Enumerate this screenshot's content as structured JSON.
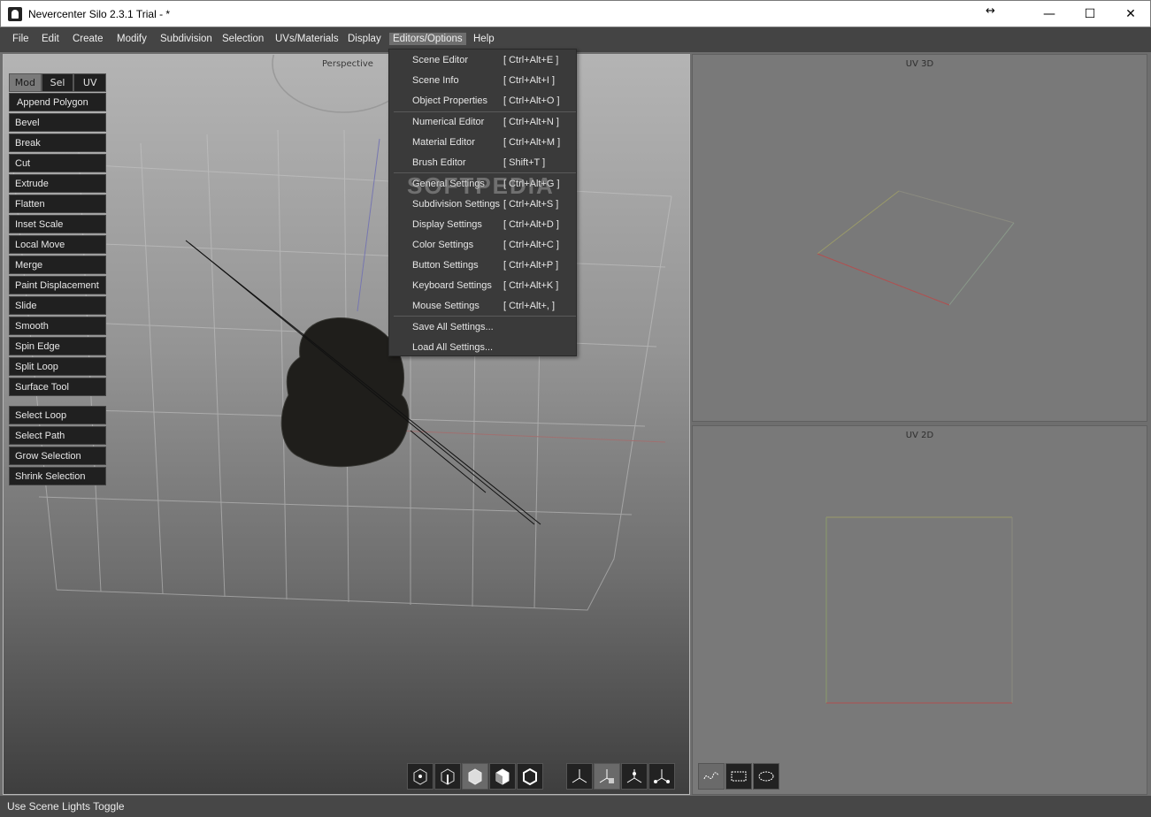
{
  "window": {
    "title": "Nevercenter Silo 2.3.1 Trial - *"
  },
  "menubar": {
    "items": [
      "File",
      "Edit",
      "Create",
      "Modify",
      "Subdivision",
      "Selection",
      "UVs/Materials",
      "Display",
      "Editors/Options",
      "Help"
    ]
  },
  "viewport": {
    "label": "Perspective"
  },
  "uv3d": {
    "label": "UV 3D"
  },
  "uv2d": {
    "label": "UV 2D"
  },
  "toolbox": {
    "tabs": [
      "Mod",
      "Sel",
      "UV"
    ],
    "tools": [
      "Append Polygon",
      "Bevel",
      "Break",
      "Cut",
      "Extrude",
      "Flatten",
      "Inset Scale",
      "Local Move",
      "Merge",
      "Paint Displacement",
      "Slide",
      "Smooth",
      "Spin Edge",
      "Split Loop",
      "Surface Tool"
    ],
    "selection_tools": [
      "Select Loop",
      "Select Path",
      "Grow Selection",
      "Shrink Selection"
    ]
  },
  "dropdown": {
    "items": [
      {
        "label": "Scene Editor",
        "shortcut": "[ Ctrl+Alt+E ]"
      },
      {
        "label": "Scene Info",
        "shortcut": "[ Ctrl+Alt+I ]"
      },
      {
        "label": "Object Properties",
        "shortcut": "[ Ctrl+Alt+O ]"
      },
      {
        "label": "Numerical Editor",
        "shortcut": "[ Ctrl+Alt+N ]"
      },
      {
        "label": "Material Editor",
        "shortcut": "[ Ctrl+Alt+M ]"
      },
      {
        "label": "Brush Editor",
        "shortcut": "[ Shift+T ]"
      },
      {
        "label": "General Settings",
        "shortcut": "[ Ctrl+Alt+G ]"
      },
      {
        "label": "Subdivision Settings",
        "shortcut": "[ Ctrl+Alt+S ]"
      },
      {
        "label": "Display Settings",
        "shortcut": "[ Ctrl+Alt+D ]"
      },
      {
        "label": "Color Settings",
        "shortcut": "[ Ctrl+Alt+C ]"
      },
      {
        "label": "Button Settings",
        "shortcut": "[ Ctrl+Alt+P ]"
      },
      {
        "label": "Keyboard Settings",
        "shortcut": "[ Ctrl+Alt+K ]"
      },
      {
        "label": "Mouse Settings",
        "shortcut": "[ Ctrl+Alt+, ]"
      },
      {
        "label": "Save All Settings...",
        "shortcut": ""
      },
      {
        "label": "Load All Settings...",
        "shortcut": ""
      }
    ]
  },
  "watermark": "SOFTPEDIA",
  "bottom_toolbar": {
    "icons": [
      "vertex-mode-icon",
      "edge-mode-icon",
      "face-mode-icon",
      "object-mode-icon",
      "wireframe-mode-icon",
      "move-manipulator-icon",
      "rotate-manipulator-icon",
      "scale-manipulator-icon",
      "universal-manipulator-icon",
      "lasso-select-icon",
      "rect-select-icon",
      "paint-select-icon"
    ]
  },
  "status": {
    "text": "Use Scene Lights Toggle"
  }
}
